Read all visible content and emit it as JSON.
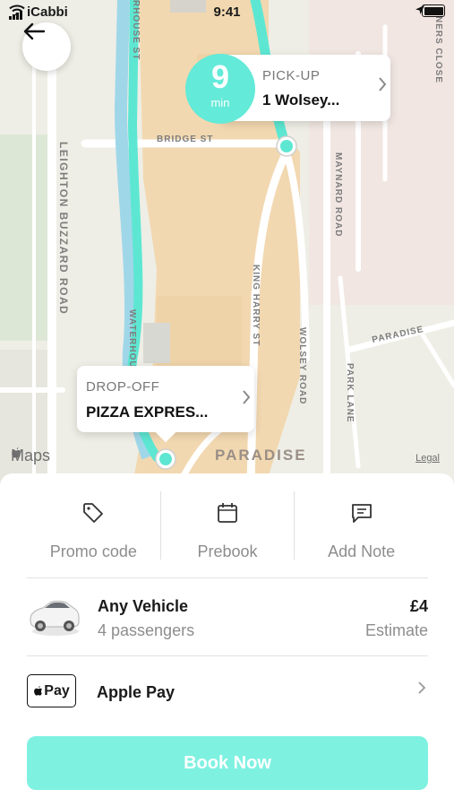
{
  "status_bar": {
    "carrier": "iCabbi",
    "time": "9:41"
  },
  "map": {
    "road_labels": {
      "bridge_st": "BRIDGE ST",
      "leighton": "LEIGHTON BUZZARD ROAD",
      "maynard": "MAYNARD ROAD",
      "king_harry": "KING HARRY ST",
      "wolsey": "WOLSEY ROAD",
      "park_lane": "PARK LANE",
      "paradise_rd": "PARADISE",
      "waterhouse_top": "RHOUSE ST",
      "waterhouse_bottom": "WATERHOU",
      "close": "NERS CLOSE"
    },
    "area_label": "PARADISE",
    "attribution": "Maps",
    "legal": "Legal"
  },
  "pickup": {
    "eta_value": "9",
    "eta_unit": "min",
    "caption": "PICK-UP",
    "address": "1 Wolsey..."
  },
  "dropoff": {
    "caption": "DROP-OFF",
    "address": "PIZZA EXPRES..."
  },
  "actions": {
    "promo": "Promo code",
    "prebook": "Prebook",
    "note": "Add Note"
  },
  "vehicle": {
    "name": "Any Vehicle",
    "passengers": "4 passengers",
    "price": "£4",
    "price_note": "Estimate"
  },
  "payment": {
    "badge": "Pay",
    "method": "Apple Pay"
  },
  "book_button": "Book Now",
  "colors": {
    "accent": "#63ead8",
    "book_button": "#7ff1e1"
  }
}
